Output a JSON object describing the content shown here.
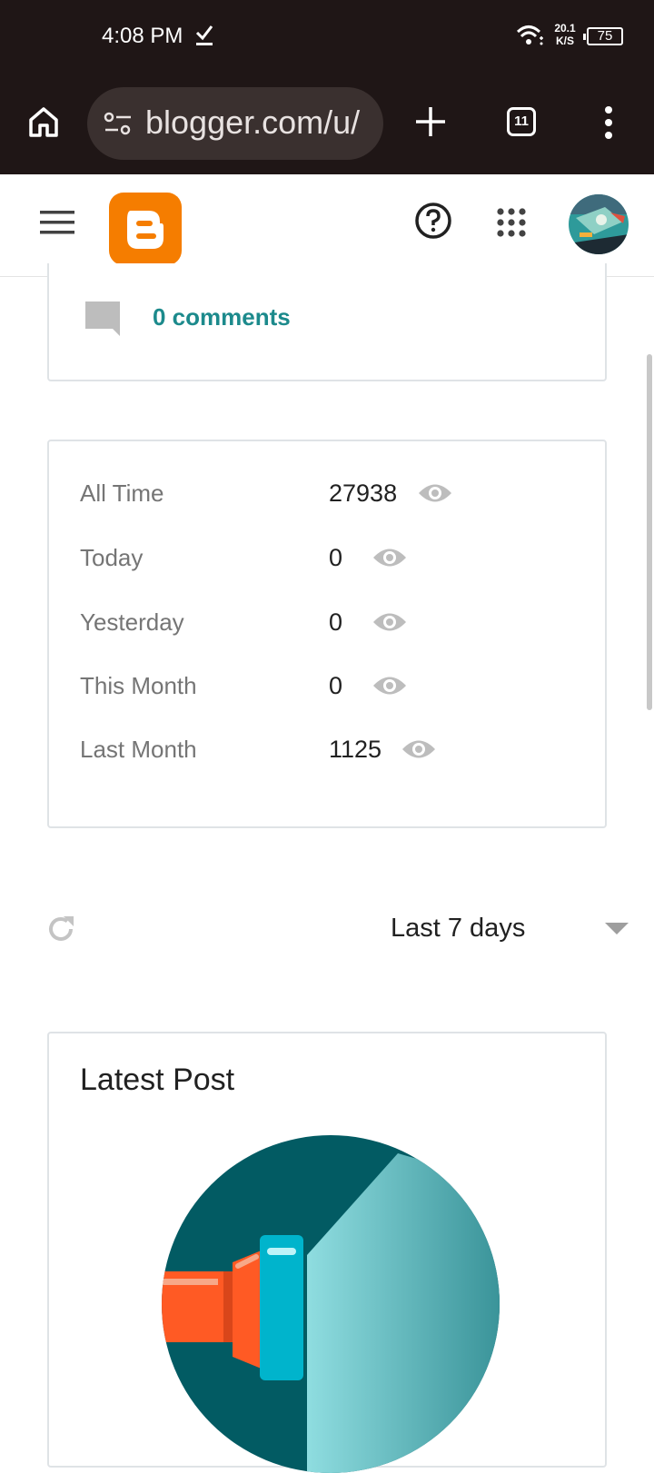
{
  "status_bar": {
    "time": "4:08 PM",
    "net_speed_value": "20.1",
    "net_speed_unit": "K/S",
    "battery": "75"
  },
  "browser": {
    "url": "blogger.com/u/",
    "tab_count": "11"
  },
  "comments": {
    "label": "0 comments"
  },
  "stats": [
    {
      "label": "All Time",
      "value": "27938"
    },
    {
      "label": "Today",
      "value": "0"
    },
    {
      "label": "Yesterday",
      "value": "0"
    },
    {
      "label": "This Month",
      "value": "0"
    },
    {
      "label": "Last Month",
      "value": "1125"
    }
  ],
  "range": {
    "selected": "Last 7 days"
  },
  "latest_post": {
    "title": "Latest Post"
  },
  "colors": {
    "accent": "#1c8a8c",
    "brand_orange": "#f57d00",
    "chrome_bg": "#1f1616"
  }
}
